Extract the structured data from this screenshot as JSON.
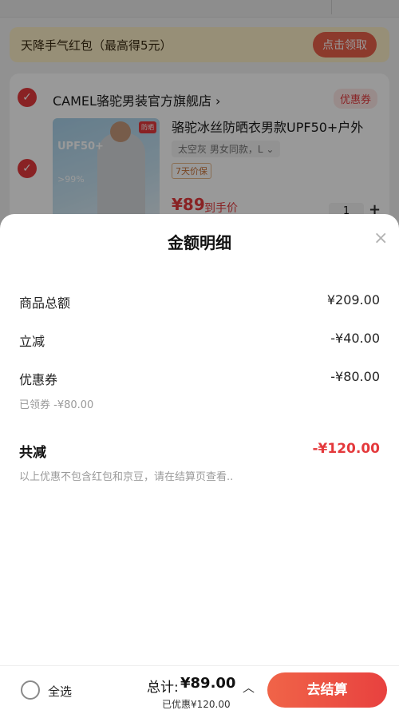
{
  "red_packet": {
    "title": "天降手气红包（最高得5元）",
    "button": "点击领取"
  },
  "store": {
    "name": "CAMEL骆驼男装官方旗舰店 ›",
    "coupon_tag": "优惠券",
    "product": {
      "title": "骆驼冰丝防晒衣男款UPF50+户外",
      "spec": "太空灰 男女同款，L ⌄",
      "guarantee": "7天价保",
      "price": "¥89",
      "price_note": "到手价",
      "quantity": "1",
      "image_text": {
        "upf": "UPF50+",
        "pct": ">99%",
        "badge": "防晒"
      }
    }
  },
  "sheet": {
    "title": "金额明细",
    "close_icon": "×",
    "rows": [
      {
        "label": "商品总额",
        "value": "¥209.00"
      },
      {
        "label": "立减",
        "value": "-¥40.00"
      },
      {
        "label": "优惠券",
        "value": "-¥80.00"
      }
    ],
    "coupon_note": "已领券 -¥80.00",
    "total_label": "共减",
    "total_value": "-¥120.00",
    "footer_note": "以上优惠不包含红包和京豆，请在结算页查看.."
  },
  "bottom_bar": {
    "select_all": "全选",
    "total_label": "总计:",
    "total_value": "¥89.00",
    "saved": "已优惠¥120.00",
    "chevron": "︿",
    "checkout": "去结算"
  },
  "colors": {
    "accent": "#e4393c",
    "button_gradient_start": "#f06448",
    "button_gradient_end": "#e8413f"
  }
}
